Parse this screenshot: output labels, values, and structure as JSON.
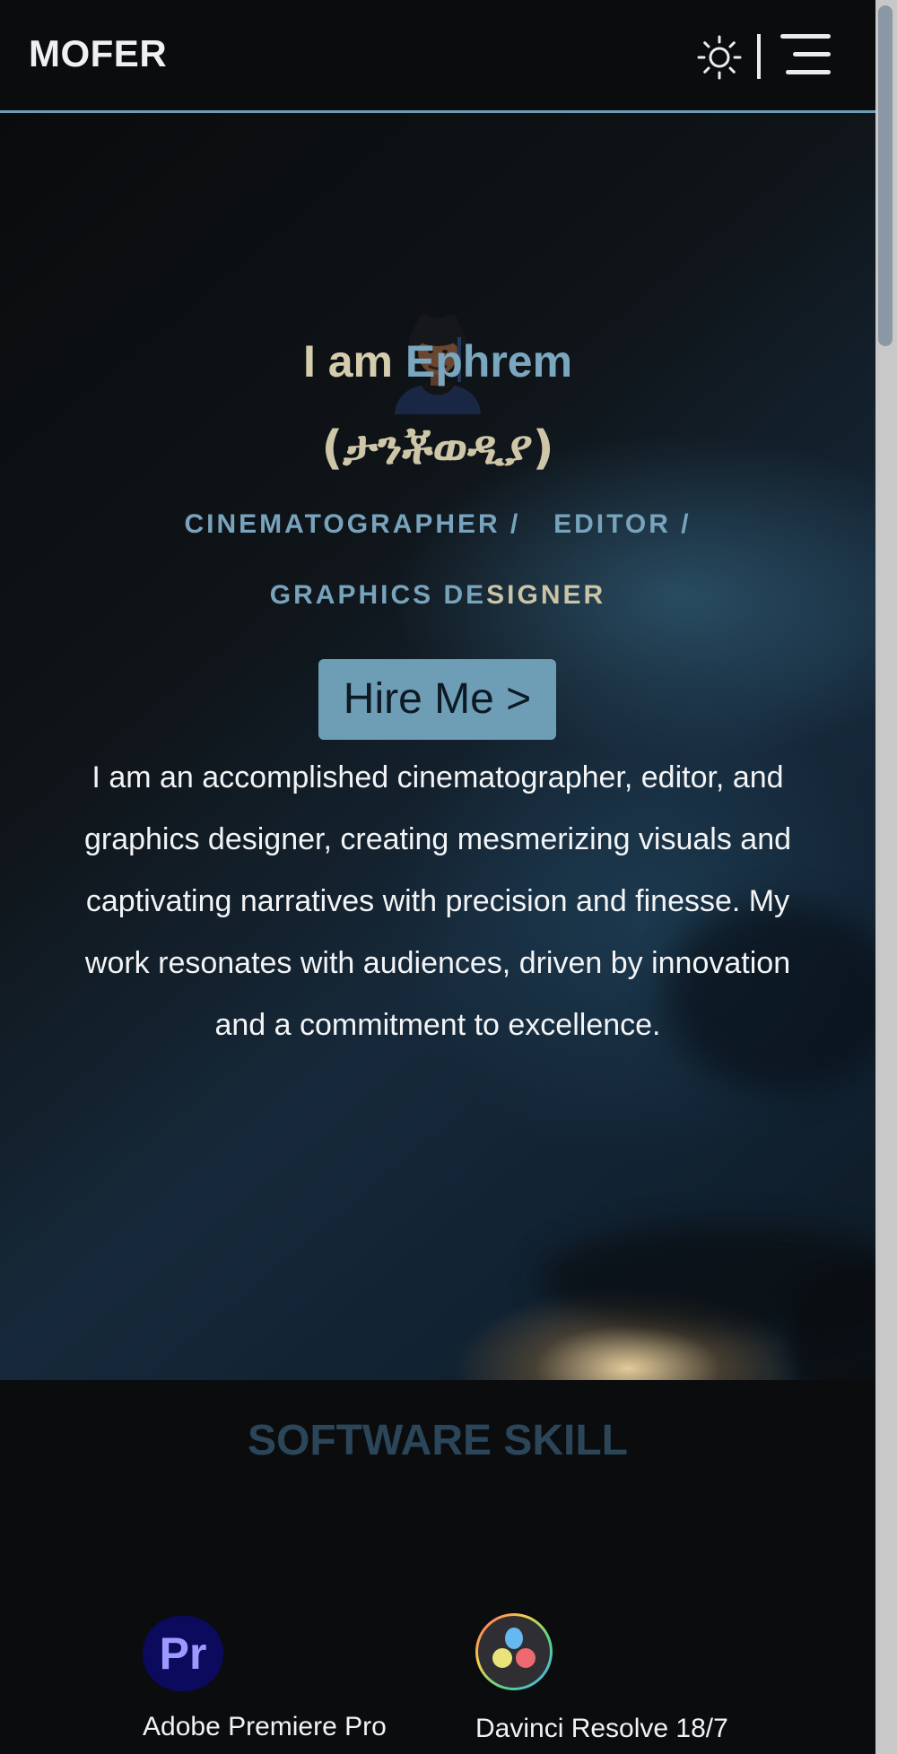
{
  "header": {
    "brand": "MOFER",
    "theme_toggle_icon": "sun-icon",
    "menu_icon": "menu-icon"
  },
  "hero": {
    "intro_prefix": "I am ",
    "intro_name": "Ephrem",
    "amharic_name": "(ታንቾወዲያ)",
    "roles_line1_a": "CINEMATOGRAPHER /",
    "roles_line1_b": "EDITOR /",
    "roles_line2_a": "GRAPHICS DE",
    "roles_line2_b": "SIGNER",
    "hire_label": "Hire Me >",
    "bio": "I am an accomplished cinematographer, editor, and graphics designer, creating mesmerizing visuals and captivating narratives with precision and finesse. My work resonates with audiences, driven by innovation and a commitment to excellence."
  },
  "skills": {
    "title": "SOFTWARE SKILL",
    "items": [
      {
        "label": "Adobe Premiere Pro",
        "icon": "premiere-pro-icon",
        "icon_text": "Pr"
      },
      {
        "label": "Davinci Resolve 18/7",
        "icon": "davinci-resolve-icon"
      }
    ]
  },
  "colors": {
    "accent": "#6e9db6",
    "sand": "#cbc3a5",
    "background": "#0b0c0e"
  }
}
